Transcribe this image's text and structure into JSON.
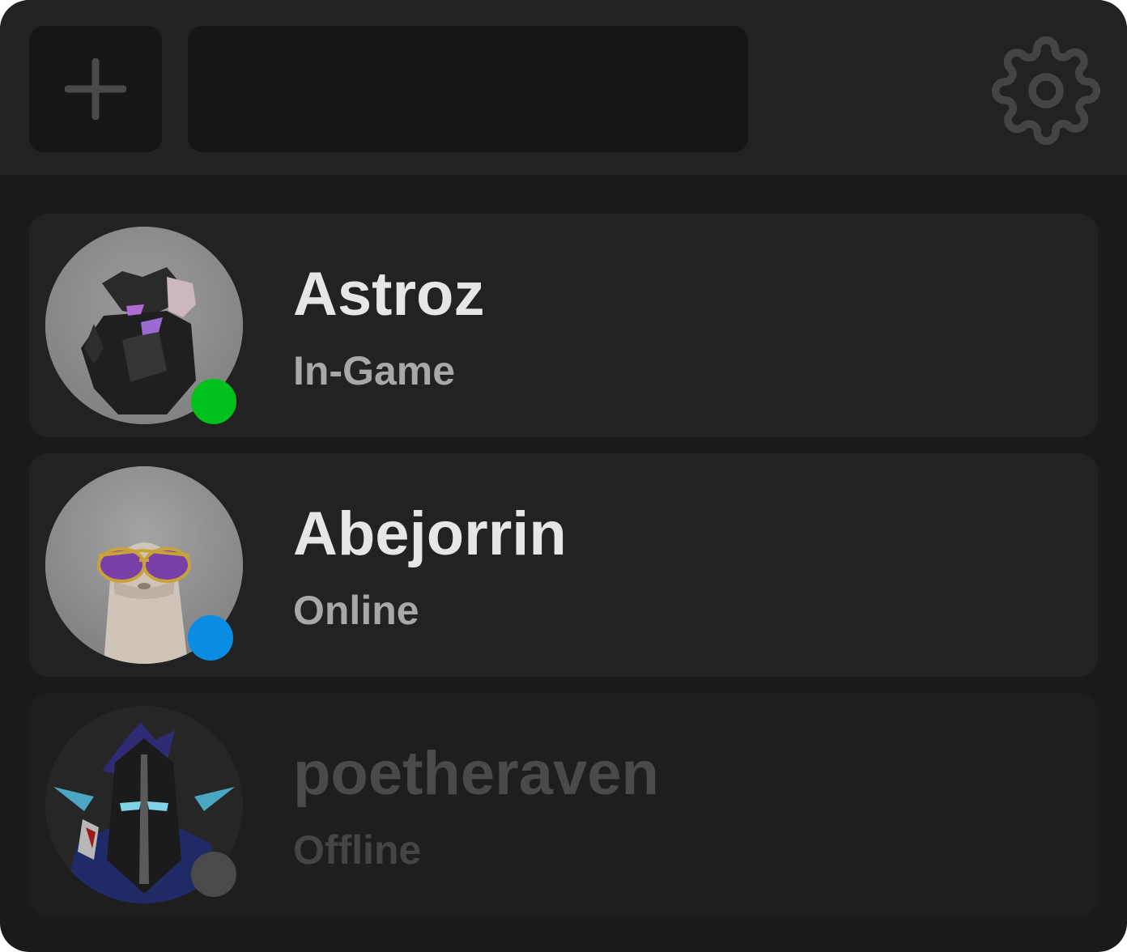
{
  "toolbar": {
    "add_icon": "plus-icon",
    "search_value": "",
    "settings_icon": "gear-icon"
  },
  "friends": [
    {
      "name": "Astroz",
      "status": "In-Game",
      "status_color": "#00c21c"
    },
    {
      "name": "Abejorrin",
      "status": "Online",
      "status_color": "#0a8be4"
    },
    {
      "name": "poetheraven",
      "status": "Offline",
      "status_color": "#4a4a4a"
    }
  ],
  "colors": {
    "window_bg": "#1a1a1a",
    "topbar_bg": "#222222",
    "card_bg": "#222222",
    "input_bg": "#161616",
    "name_text": "#e6e6e6",
    "status_text": "#a8a8a8",
    "offline_text": "#4a4a4a"
  }
}
